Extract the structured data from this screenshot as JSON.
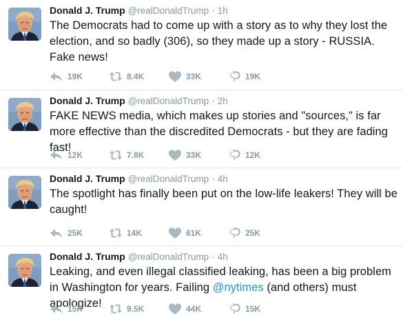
{
  "tweets": [
    {
      "fullname": "Donald J. Trump",
      "username": "@realDonaldTrump",
      "separator": "·",
      "time": "1h",
      "text": "The Democrats had to come up with a story as to why they lost the election, and so badly (306), so they made up a story - RUSSIA. Fake news!",
      "replies": "19K",
      "retweets": "8.4K",
      "likes": "33K",
      "dm": "19K"
    },
    {
      "fullname": "Donald J. Trump",
      "username": "@realDonaldTrump",
      "separator": "·",
      "time": "2h",
      "text": "FAKE NEWS media, which makes up stories and \"sources,\" is far more effective than the discredited Democrats - but they are fading fast!",
      "replies": "12K",
      "retweets": "7.8K",
      "likes": "33K",
      "dm": "12K"
    },
    {
      "fullname": "Donald J. Trump",
      "username": "@realDonaldTrump",
      "separator": "·",
      "time": "4h",
      "text": "The spotlight has finally been put on the low-life leakers! They will be caught!",
      "replies": "25K",
      "retweets": "14K",
      "likes": "61K",
      "dm": "25K"
    },
    {
      "fullname": "Donald J. Trump",
      "username": "@realDonaldTrump",
      "separator": "·",
      "time": "4h",
      "text_before": "Leaking, and even illegal classified leaking, has been a big problem in Washington for years. Failing ",
      "mention": "@nytimes",
      "text_after": " (and others) must apologize!",
      "replies": "15K",
      "retweets": "9.5K",
      "likes": "44K",
      "dm": "15K"
    }
  ],
  "colors": {
    "secondary_text": "#8899a6",
    "icon": "#aab8c2",
    "link": "#1b95e0",
    "divider": "#e1e8ed"
  },
  "icons": {
    "reply": "reply-icon",
    "retweet": "retweet-icon",
    "like": "heart-icon",
    "direct_message": "direct-message-icon"
  }
}
